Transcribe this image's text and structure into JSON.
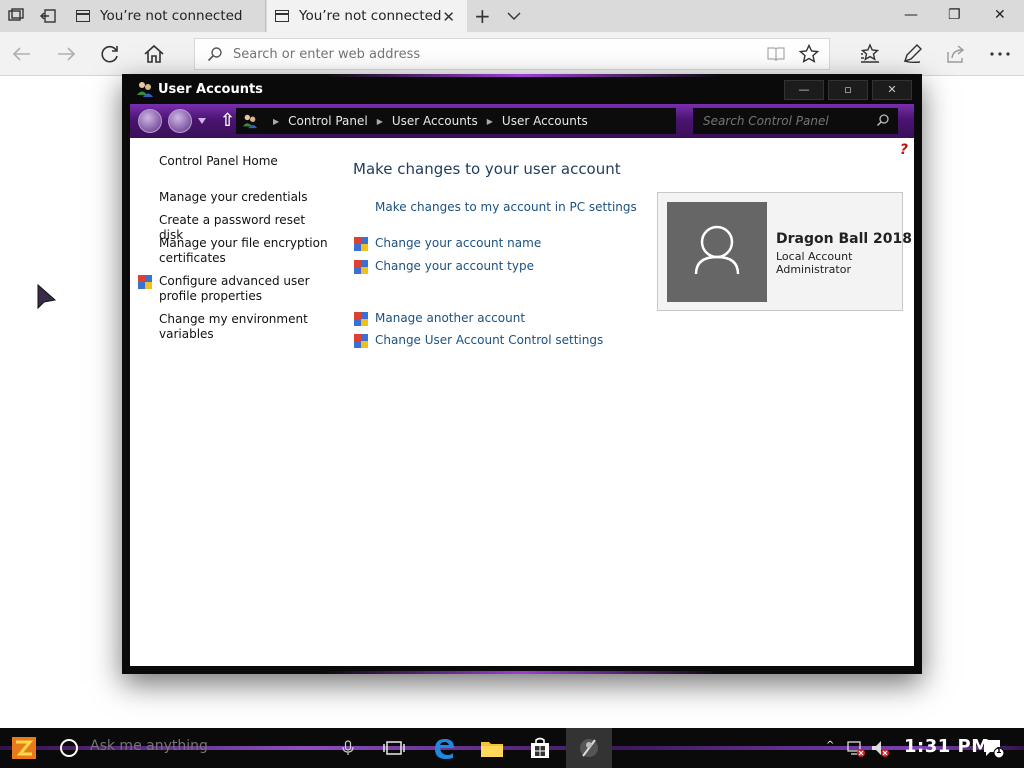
{
  "browser": {
    "tabs": [
      {
        "title": "You’re not connected",
        "active": false
      },
      {
        "title": "You’re not connected",
        "active": true
      }
    ],
    "close_tab_glyph": "✕",
    "new_tab_glyph": "+",
    "address_placeholder": "Search or enter web address",
    "window_controls": {
      "minimize": "—",
      "restore": "❐",
      "close": "✕"
    },
    "icons": [
      "tab-preview-icon",
      "set-aside-tabs-icon",
      "back-icon",
      "forward-icon",
      "refresh-icon",
      "home-icon",
      "reading-view-icon",
      "favorite-star-icon",
      "favorites-hub-icon",
      "notes-pen-icon",
      "share-icon",
      "more-icon"
    ]
  },
  "window": {
    "title": "User Accounts",
    "buttons": {
      "minimize": "—",
      "maximize": "▫",
      "close": "✕"
    },
    "breadcrumb": [
      "Control Panel",
      "User Accounts",
      "User Accounts"
    ],
    "search_placeholder": "Search Control Panel",
    "help_glyph": "?",
    "left_pane": {
      "home": "Control Panel Home",
      "items": [
        "Manage your credentials",
        "Create a password reset disk",
        "Manage your file encryption certificates",
        "Configure advanced user profile properties",
        "Change my environment variables"
      ]
    },
    "main": {
      "heading": "Make changes to your user account",
      "links": [
        "Make changes to my account in PC settings",
        "Change your account name",
        "Change your account type",
        "Manage another account",
        "Change User Account Control settings"
      ]
    },
    "account": {
      "name": "Dragon Ball 2018",
      "type": "Local Account",
      "role": "Administrator"
    }
  },
  "taskbar": {
    "search_placeholder": "Ask me anything",
    "time": "1:31 PM",
    "notification_count": "1",
    "tray_chevron": "^"
  },
  "colors": {
    "accent_purple": "#a03cd8",
    "link_blue": "#1c5180",
    "heading_blue": "#1e3d5e",
    "window_frame": "#0a0a0a"
  }
}
